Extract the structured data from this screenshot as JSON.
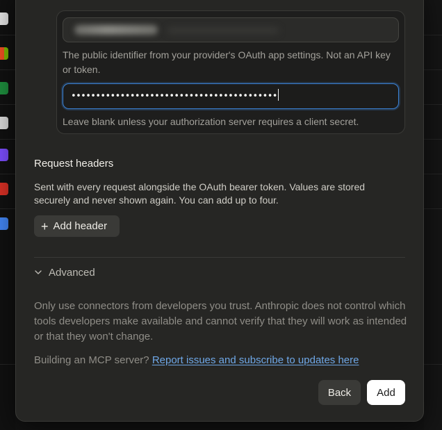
{
  "oauth": {
    "client_id_hint": "The public identifier from your provider's OAuth app settings. Not an API key or token.",
    "client_secret_value": "••••••••••••••••••••••••••••••••••••••••••",
    "client_secret_hint": "Leave blank unless your authorization server requires a client secret."
  },
  "headers": {
    "title": "Request headers",
    "description": "Sent with every request alongside the OAuth bearer token. Values are stored securely and never shown again. You can add up to four.",
    "add_label": "Add header"
  },
  "advanced": {
    "label": "Advanced",
    "icon": "chevron-down-icon"
  },
  "footer": {
    "trust_text": "Only use connectors from developers you trust. Anthropic does not control which tools developers make available and cannot verify that they will work as intended or that they won't change.",
    "mcp_prefix": "Building an MCP server?",
    "mcp_link": "Report issues and subscribe to updates here",
    "back_label": "Back",
    "add_label": "Add"
  },
  "colors": {
    "focus_ring": "#3b82d6",
    "link": "#6fa8e8",
    "primary_button": "#ffffff"
  }
}
